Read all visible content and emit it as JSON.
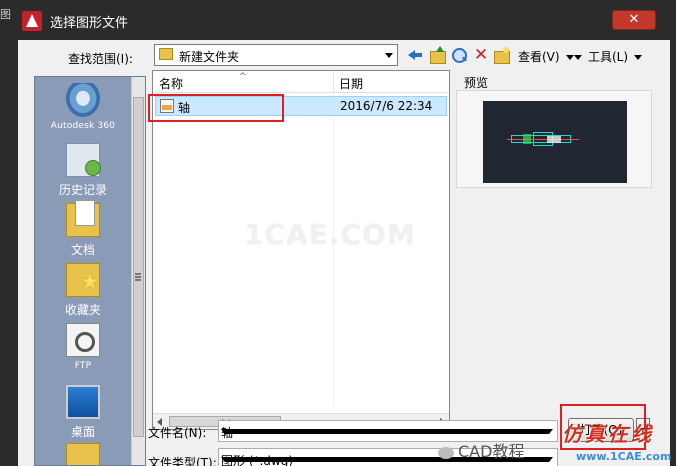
{
  "window": {
    "title": "选择图形文件",
    "close_label": "✕",
    "left_edge_glyph": "图"
  },
  "toolbar": {
    "lookin_label": "查找范围(I):",
    "lookin_value": "新建文件夹",
    "delete_glyph": "✕",
    "view_label": "查看(V)",
    "tools_label": "工具(L)"
  },
  "places": [
    {
      "label": "Autodesk 360",
      "icon": "autodesk-360-icon"
    },
    {
      "label": "历史记录",
      "icon": "history-icon"
    },
    {
      "label": "文档",
      "icon": "documents-icon"
    },
    {
      "label": "收藏夹",
      "icon": "favorites-icon"
    },
    {
      "label": "FTP",
      "icon": "ftp-icon"
    },
    {
      "label": "桌面",
      "icon": "desktop-icon"
    }
  ],
  "filelist": {
    "columns": {
      "name": "名称",
      "date": "日期",
      "sort_glyph": "^"
    },
    "rows": [
      {
        "name": "轴",
        "date": "2016/7/6 22:34"
      }
    ]
  },
  "preview": {
    "label": "预览"
  },
  "bottom": {
    "filename_label": "文件名(N):",
    "filename_value": "轴",
    "filetype_label": "文件类型(T):",
    "filetype_value": "图形 (*.dwg)",
    "open_label": "打开(O)"
  },
  "overlays": {
    "watermark": "1CAE.COM",
    "wechat": "CAD教程",
    "brand": "仿真在线",
    "brand_url": "www.1CAE.com"
  },
  "colors": {
    "highlight": "#e02020",
    "selection": "#cce8ff",
    "places_bg": "#8a9bb8",
    "title_bg": "#2b2b2b"
  }
}
